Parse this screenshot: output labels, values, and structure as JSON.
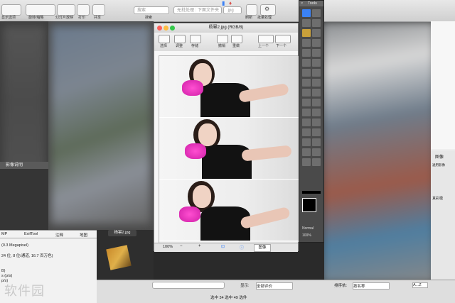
{
  "toolbar": {
    "items": [
      "显示选项",
      "旋转/缩略",
      "幻灯片放映",
      "打印",
      "共享",
      "搜索"
    ],
    "search_placeholder": "搜索",
    "filename_field": "无批处理 : 下面文件夹",
    "ext_field": ".jpg",
    "refresh_label": "刷新",
    "settings_label": "批量处理"
  },
  "left_panel": {
    "header": "影像说明"
  },
  "info_panel": {
    "tabs": [
      "MP",
      "ExifTool",
      "注释",
      "地图"
    ],
    "lines": [
      "(0.3 Megapixel)",
      "24 位, 8 位/通道, 16.7 百万色)",
      "B)",
      "s (p/s)",
      "p/s)"
    ]
  },
  "image_window": {
    "title": "杨幂2.jpg (RGB/8)",
    "tools": [
      "选择",
      "调整",
      "存储",
      "撤销",
      "重做",
      "上一个",
      "下一个"
    ],
    "zoom": "100%",
    "status_field": "图像",
    "thumb_label": "杨幂2.jpg"
  },
  "tools_palette": {
    "title": "Tools",
    "mode": "Normal",
    "opacity": "100%"
  },
  "right_panel": {
    "header": "图像",
    "subtitle": "通用影像",
    "label": "真彩模"
  },
  "bottom_bar": {
    "show_label": "显示:",
    "show_value": "全部评价",
    "sort_label": "排序依:",
    "sort_value": "按名称",
    "sort_az": "A...Z",
    "status": "选中 34 选中 49 选件"
  },
  "watermark": "软件园",
  "colors": {
    "accent": "#3b82f6",
    "toolbar": "#dcdcdc",
    "dark_bg": "#2a2a2a"
  }
}
